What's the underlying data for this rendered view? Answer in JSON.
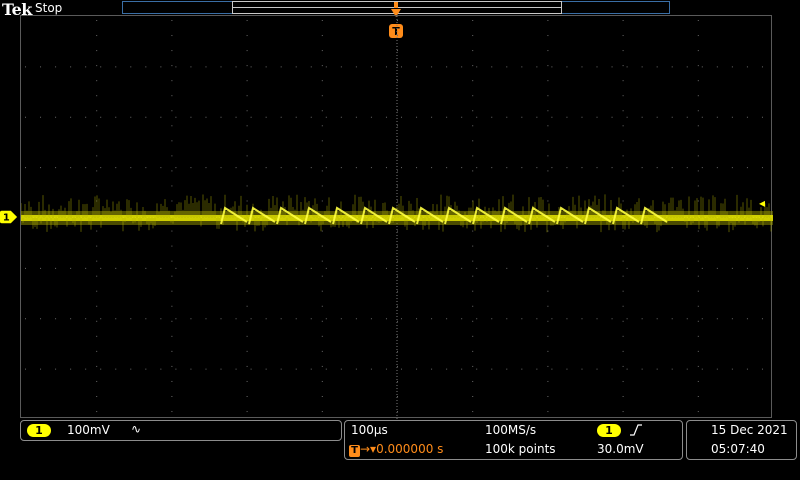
{
  "header": {
    "brand": "Tek",
    "acquisition_status": "Stop"
  },
  "channel1": {
    "label": "1",
    "color": "#ffff00",
    "scale": "100mV",
    "coupling_icon": "∿"
  },
  "trigger": {
    "marker": "T",
    "position_label": "0.000000 s",
    "source": "1",
    "slope_icon": "rising-edge-icon",
    "level": "30.0mV",
    "color": "#ff8c1a"
  },
  "horizontal": {
    "scale": "100µs",
    "sample_rate": "100MS/s",
    "record_length": "100k points"
  },
  "datetime": {
    "date": "15 Dec  2021",
    "time": "05:07:40"
  }
}
